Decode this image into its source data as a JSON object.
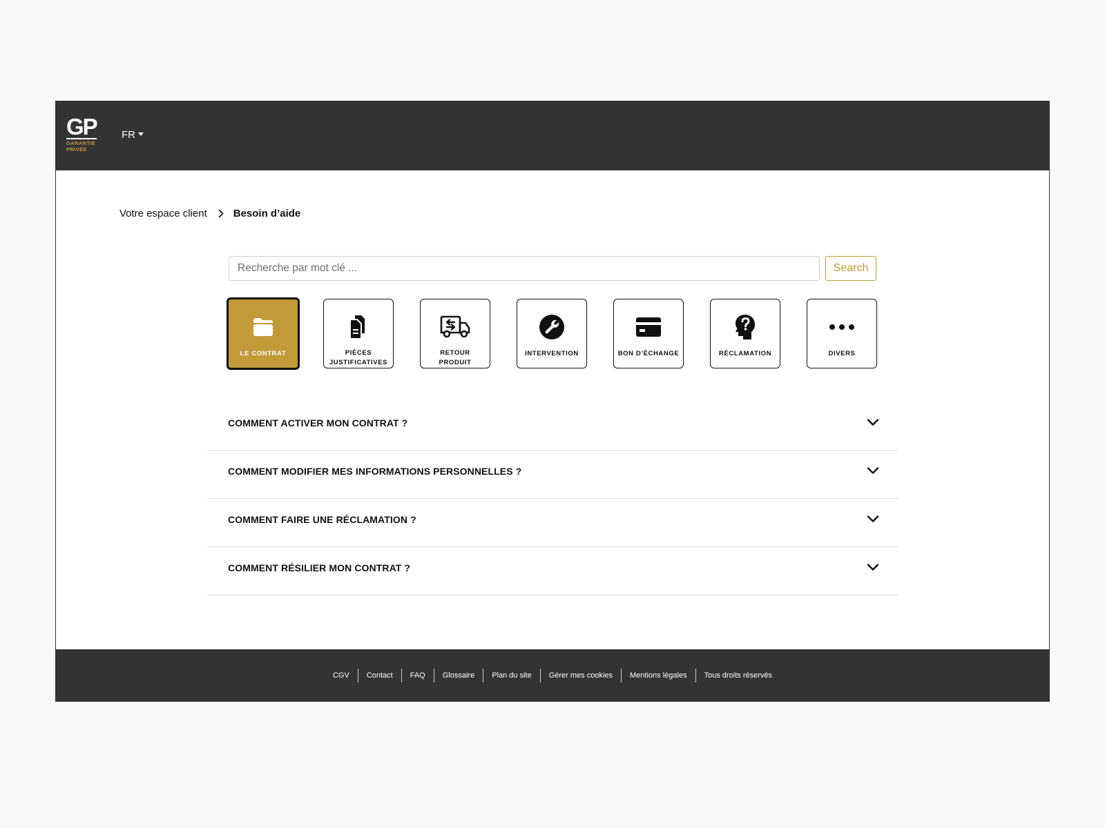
{
  "header": {
    "logo": {
      "mark": "GP",
      "line1": "GARANTIE",
      "line2": "PRIVÉE"
    },
    "language": "FR"
  },
  "breadcrumb": {
    "parent": "Votre espace client",
    "current": "Besoin d’aide"
  },
  "search": {
    "placeholder": "Recherche par mot clé ...",
    "value": "",
    "button": "Search"
  },
  "categories": [
    {
      "label": "Le contrat",
      "icon": "folder-icon",
      "active": true
    },
    {
      "label": "Pièces justificatives",
      "icon": "documents-icon",
      "active": false
    },
    {
      "label": "Retour produit",
      "icon": "truck-return-icon",
      "active": false
    },
    {
      "label": "Intervention",
      "icon": "wrench-icon",
      "active": false
    },
    {
      "label": "Bon d’échange",
      "icon": "card-icon",
      "active": false
    },
    {
      "label": "Réclamation",
      "icon": "head-question-icon",
      "active": false
    },
    {
      "label": "Divers",
      "icon": "more-dots-icon",
      "active": false
    }
  ],
  "faq": [
    "COMMENT ACTIVER MON CONTRAT ?",
    "COMMENT MODIFIER MES INFORMATIONS PERSONNELLES ?",
    "COMMENT FAIRE UNE RÉCLAMATION ?",
    "COMMENT RÉSILIER MON CONTRAT ?"
  ],
  "footer": [
    "CGV",
    "Contact",
    "FAQ",
    "Glossaire",
    "Plan du site",
    "Gérer mes cookies",
    "Mentions légales",
    "Tous droits réservés"
  ],
  "colors": {
    "accent": "#c29a3a",
    "dark": "#333333",
    "background": "#f8f8f8"
  }
}
